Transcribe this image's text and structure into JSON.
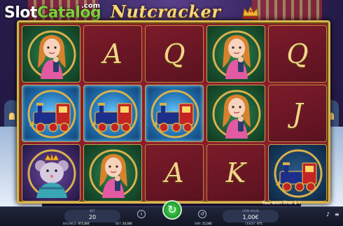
{
  "logo": {
    "slot": "Slot",
    "catalog": "Catalog",
    "com": ".com"
  },
  "game": {
    "title": "Nutcracker",
    "crown_icon": "crown-icon"
  },
  "colors": {
    "frame_gold": "#d9b44f",
    "reel_red": "#8a1d2c",
    "spin_green": "#1f9a2e",
    "bar_bg": "#121624"
  },
  "reels": [
    [
      {
        "type": "girl",
        "bg": "green"
      },
      {
        "type": "train",
        "bg": "blue"
      },
      {
        "type": "mouse-king",
        "bg": "purple"
      }
    ],
    [
      {
        "type": "letter",
        "letter": "A"
      },
      {
        "type": "train",
        "bg": "blue"
      },
      {
        "type": "girl",
        "bg": "green"
      }
    ],
    [
      {
        "type": "letter",
        "letter": "Q"
      },
      {
        "type": "train",
        "bg": "blue"
      },
      {
        "type": "letter",
        "letter": "A"
      }
    ],
    [
      {
        "type": "girl",
        "bg": "green"
      },
      {
        "type": "girl",
        "bg": "green"
      },
      {
        "type": "letter",
        "letter": "K"
      }
    ],
    [
      {
        "type": "letter",
        "letter": "Q"
      },
      {
        "type": "letter",
        "letter": "J"
      },
      {
        "type": "train",
        "bg": "dark"
      }
    ]
  ],
  "controls": {
    "bet_label": "BET",
    "bet_value": "20",
    "coin_value_label": "COIN VALUE",
    "coin_value": "1,00€",
    "spin_icon": "spin-icon",
    "info_icon": "info-icon",
    "autoplay_icon": "autoplay-icon",
    "menu_icon": "menu-icon",
    "sound_icon": "sound-icon"
  },
  "info": {
    "balance_label": "BALANCE:",
    "balance_value": "975,80€",
    "bet_label": "BET:",
    "bet_value": "20,00€",
    "win_label": "WIN:",
    "win_value": "15,00€",
    "credit_label": "CREDIT:",
    "credit_value": "975"
  },
  "win_message": "You won line 1 !"
}
